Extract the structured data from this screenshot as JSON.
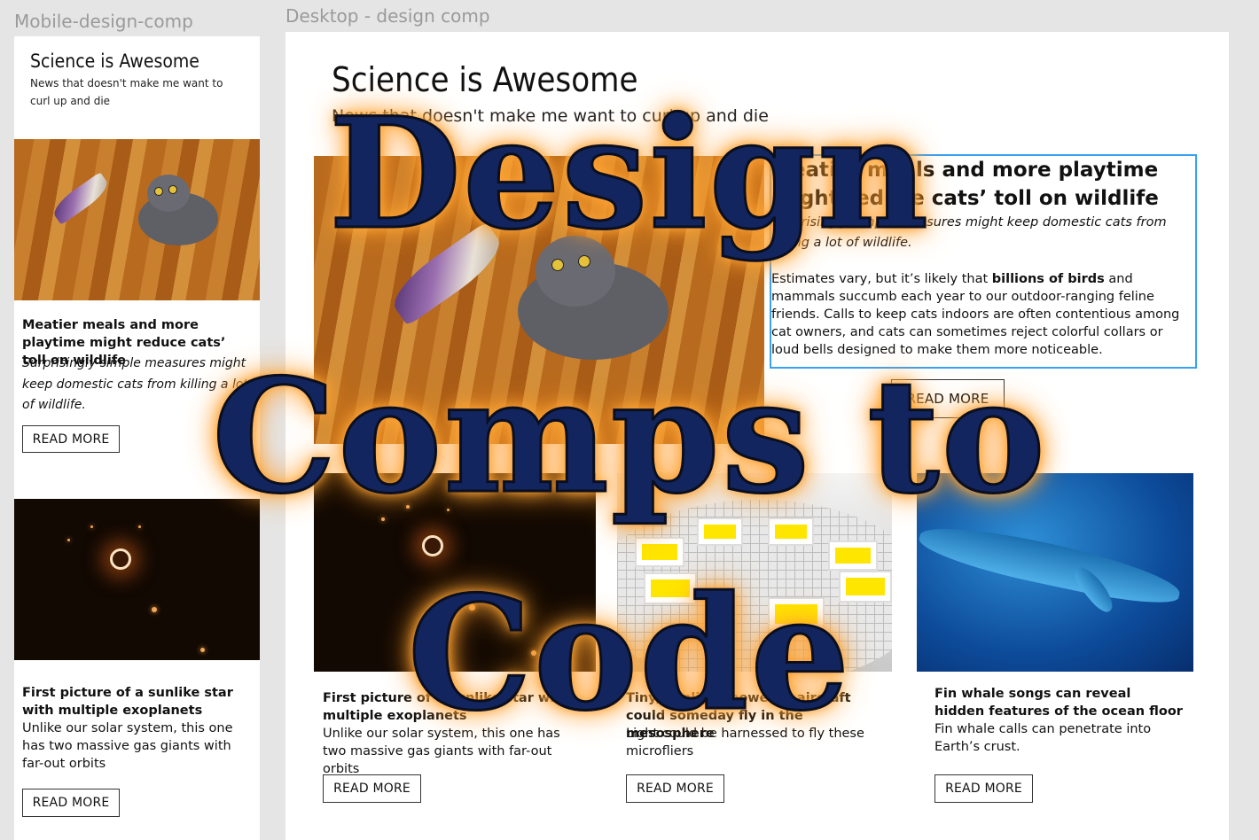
{
  "frames": {
    "mobile_label": "Mobile-design-comp",
    "desktop_label": "Desktop - design comp"
  },
  "site": {
    "title": "Science is Awesome",
    "tagline": "News that doesn't make me want to curl up and die"
  },
  "articles": {
    "cat": {
      "headline": "Meatier meals and more playtime might reduce cats’ toll on wildlife",
      "dek": "Surprisingly simple measures might keep domestic cats from killing a lot of wildlife.",
      "body_start": "Estimates vary, but it’s likely that ",
      "body_bold": "billions of birds",
      "body_end": " and mammals succumb each year to our outdoor-ranging feline friends. Calls to keep cats indoors are often contentious among cat owners, and cats can sometimes reject colorful collars or loud bells designed to make them more noticeable.",
      "button": "READ MORE"
    },
    "star": {
      "headline": "First picture of a sunlike star with multiple exoplanets",
      "summary_mobile": "Unlike our solar system, this one has two massive gas giants with far-out orbits",
      "summary_desktop": "Unlike our solar system, this one has two massive gas giants with far-out orbits",
      "button": "READ MORE"
    },
    "craft": {
      "headline": "Tiny, sunlight-powered aircraft could someday fly in the mesosphere",
      "summary": "Light could be harnessed to fly these microfliers",
      "button": "READ MORE"
    },
    "whale": {
      "headline": "Fin whale songs can reveal hidden features of the ocean floor",
      "summary": "Fin whale calls can penetrate into Earth’s crust.",
      "button": "READ MORE"
    }
  },
  "overlay_title": {
    "line1": "Design",
    "line2": "Comps to",
    "line3": "Code"
  },
  "colors": {
    "overlay_fill": "#13255e",
    "overlay_glow": "#ff9b2b",
    "selection": "#3aa0f2"
  }
}
